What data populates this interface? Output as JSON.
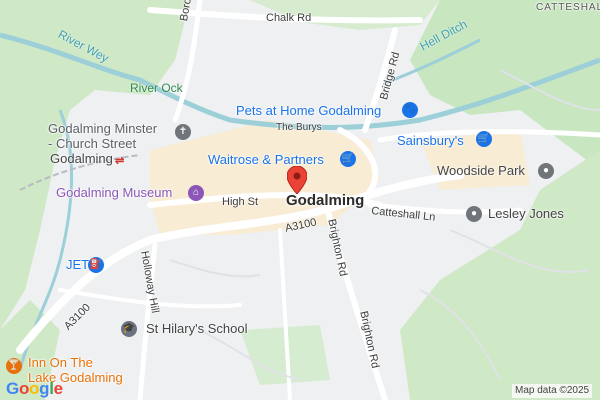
{
  "map": {
    "town": "Godalming",
    "places": {
      "catteshall_top": "CATTESHALL",
      "godalming_station": "Godalming",
      "woodside_park": "Woodside Park",
      "lesley_jones": "Lesley Jones",
      "burys": "The Burys"
    },
    "roads": {
      "chalk_rd": "Chalk Rd",
      "borough_rd": "Borough Rd",
      "bridge_rd": "Bridge Rd",
      "high_st": "High St",
      "catteshall_ln": "Catteshall Ln",
      "a3100_center": "A3100",
      "a3100_left": "A3100",
      "brighton_rd_1": "Brighton Rd",
      "brighton_rd_2": "Brighton Rd",
      "holloway_hill": "Holloway Hill"
    },
    "water": {
      "river_wey": "River Wey",
      "river_ock": "River Ock",
      "hell_ditch": "Hell Ditch"
    },
    "pois": {
      "minster": "Godalming Minster\n- Church Street",
      "pets": "Pets at Home Godalming",
      "waitrose": "Waitrose & Partners",
      "sainsburys": "Sainsbury's",
      "museum": "Godalming Museum",
      "jet": "JET",
      "st_hilarys": "St Hilary's School",
      "inn": "Inn On The\nLake Godalming"
    },
    "branding": {
      "google": "Google",
      "map_data": "Map data ©2025"
    },
    "colors": {
      "poi_blue": "#1a73e8",
      "museum_purple": "#8c56b8",
      "hotel_orange": "#e8710a",
      "marker_red": "#ea4335",
      "greenspace": "#c8e6c0"
    }
  }
}
